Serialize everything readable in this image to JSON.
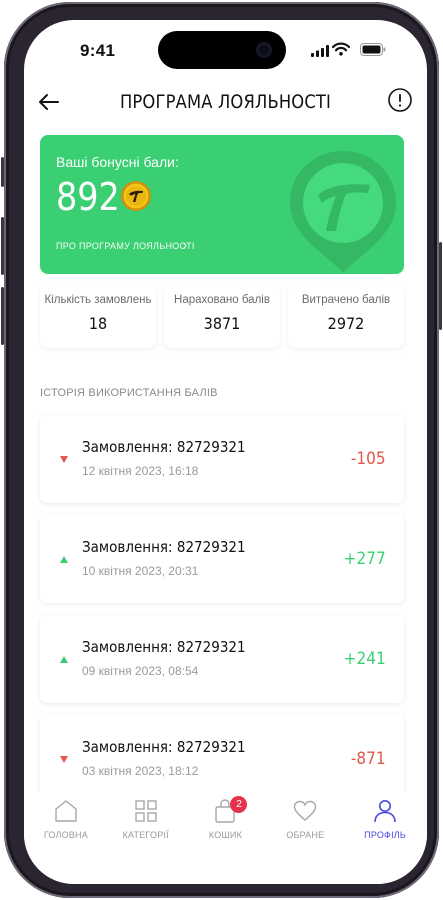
{
  "status": {
    "time": "9:41"
  },
  "header": {
    "title": "ПРОГРАМА ЛОЯЛЬНОСТІ"
  },
  "bonus_card": {
    "label": "Ваші бонусні бали:",
    "points": "892",
    "link": "ПРО ПРОГРАМУ ЛОЯЛЬНОСТІ",
    "color": "#3bcf73"
  },
  "stats": [
    {
      "label": "Кількість замовлень",
      "value": "18"
    },
    {
      "label": "Нараховано балів",
      "value": "3871"
    },
    {
      "label": "Витрачено балів",
      "value": "2972"
    }
  ],
  "history": {
    "section_title": "ІСТОРІЯ ВИКОРИСТАННЯ БАЛІВ",
    "items": [
      {
        "title": "Замовлення: 82729321",
        "date": "12 квітня 2023, 16:18",
        "amount": "-105",
        "direction": "down"
      },
      {
        "title": "Замовлення: 82729321",
        "date": "10 квітня 2023, 20:31",
        "amount": "+277",
        "direction": "up"
      },
      {
        "title": "Замовлення: 82729321",
        "date": "09 квітня 2023, 08:54",
        "amount": "+241",
        "direction": "up"
      },
      {
        "title": "Замовлення: 82729321",
        "date": "03 квітня 2023, 18:12",
        "amount": "-871",
        "direction": "down"
      }
    ]
  },
  "tabbar": {
    "items": [
      {
        "label": "ГОЛОВНА",
        "icon": "home-icon"
      },
      {
        "label": "КАТЕГОРІЇ",
        "icon": "grid-icon"
      },
      {
        "label": "КОШИК",
        "icon": "bag-icon",
        "badge": "2"
      },
      {
        "label": "ОБРАНЕ",
        "icon": "heart-icon"
      },
      {
        "label": "ПРОФІЛЬ",
        "icon": "user-icon",
        "active": true
      }
    ],
    "active_color": "#4a47e0",
    "badge_color": "#e3344c"
  },
  "colors": {
    "negative": "#e0584c",
    "positive": "#3bcf73"
  }
}
